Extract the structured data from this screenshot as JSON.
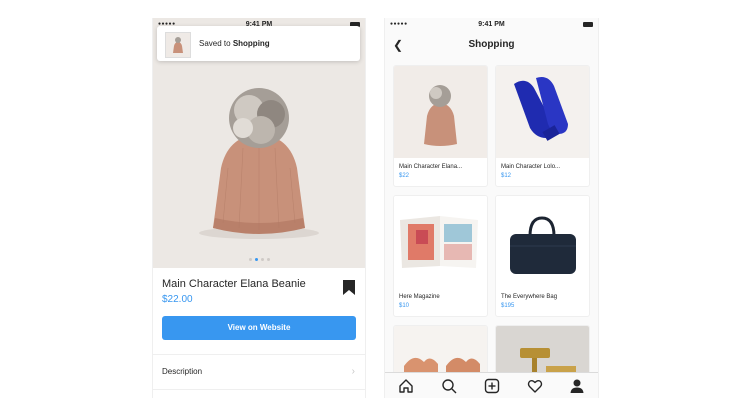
{
  "left_screen": {
    "status": {
      "signal": "●●●●●",
      "time": "9:41 PM"
    },
    "toast": {
      "prefix": "Saved to",
      "collection": "Shopping"
    },
    "product": {
      "name": "Main Character Elana Beanie",
      "price": "$22.00",
      "photo_count": 4,
      "active_photo": 1
    },
    "cta_label": "View on Website",
    "description_label": "Description"
  },
  "right_screen": {
    "status": {
      "signal": "●●●●●",
      "time": "9:41 PM"
    },
    "title": "Shopping",
    "items": [
      {
        "name": "Main Character Elana...",
        "price": "$22",
        "image": "beanie"
      },
      {
        "name": "Main Character Lolo...",
        "price": "$12",
        "image": "mittens"
      },
      {
        "name": "Here Magazine",
        "price": "$10",
        "image": "magazine"
      },
      {
        "name": "The Everywhere Bag",
        "price": "$195",
        "image": "bag"
      },
      {
        "name": "",
        "price": "",
        "image": "hands"
      },
      {
        "name": "",
        "price": "",
        "image": "gavel"
      }
    ],
    "tabs": [
      "home-icon",
      "search-icon",
      "new-post-icon",
      "heart-icon",
      "profile-icon"
    ]
  },
  "colors": {
    "accent": "#3897f0",
    "text": "#262626",
    "divider": "#efefef"
  }
}
